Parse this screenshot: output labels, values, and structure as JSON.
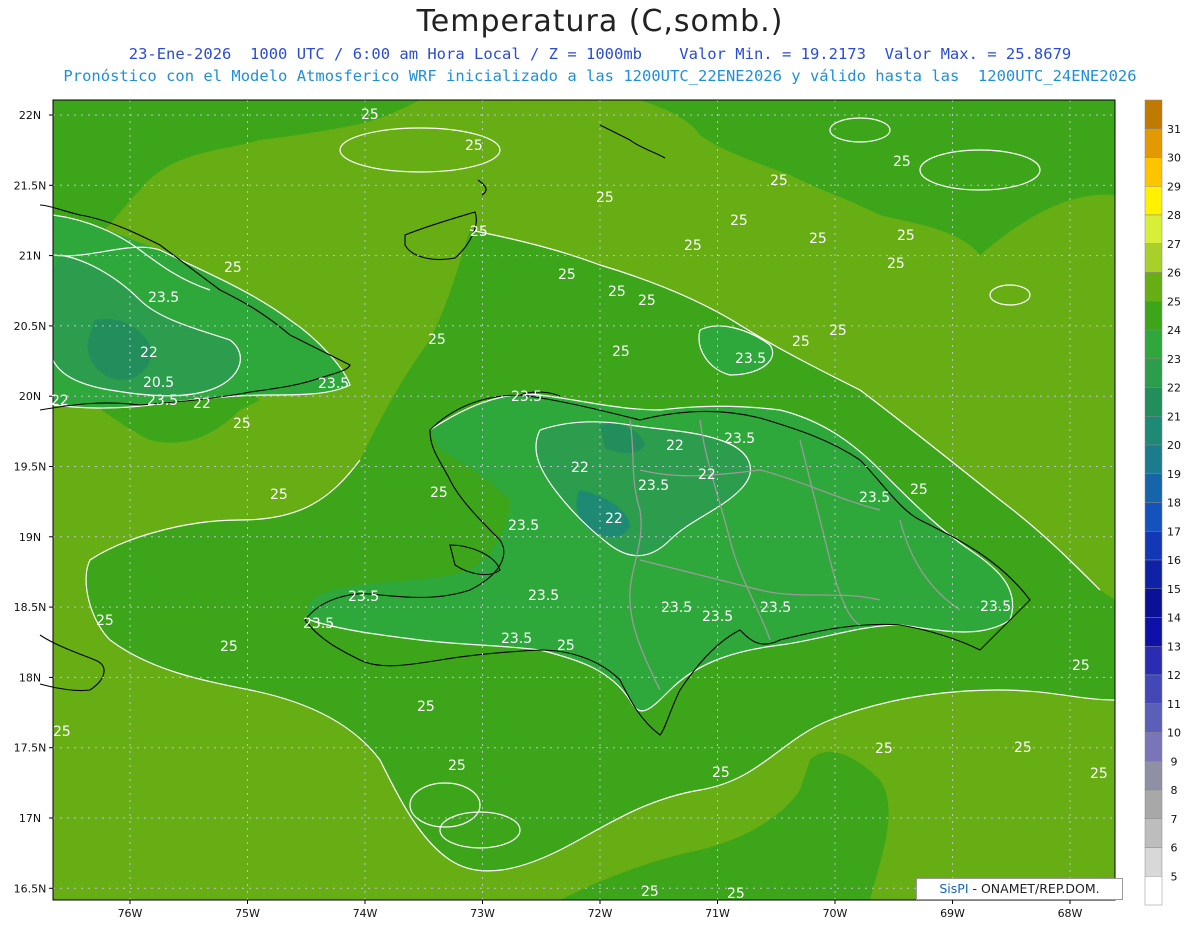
{
  "title": "Temperatura (C,somb.)",
  "subtitle_line1": "23-Ene-2026  1000 UTC / 6:00 am Hora Local / Z = 1000mb    Valor Min. = 19.2173  Valor Max. = 25.8679",
  "subtitle_line2": "Pronóstico con el Modelo Atmosferico WRF inicializado a las 1200UTC_22ENE2026 y válido hasta las  1200UTC_24ENE2026",
  "credit": {
    "brand": "SisPI",
    "text": " - ONAMET/REP.DOM."
  },
  "lat_labels": [
    "22N",
    "21.5N",
    "21N",
    "20.5N",
    "20N",
    "19.5N",
    "19N",
    "18.5N",
    "18N",
    "17.5N",
    "17N",
    "16.5N"
  ],
  "lon_labels": [
    "76W",
    "75W",
    "74W",
    "73W",
    "72W",
    "71W",
    "70W",
    "69W",
    "68W"
  ],
  "contour_labels": [
    "25",
    "23.5",
    "22",
    "20.5"
  ],
  "colorbar": {
    "levels": [
      {
        "value": "31",
        "color": "#c07a00"
      },
      {
        "value": "30",
        "color": "#e29a00"
      },
      {
        "value": "29",
        "color": "#ffc400"
      },
      {
        "value": "28",
        "color": "#fff100"
      },
      {
        "value": "27",
        "color": "#d8ef3a"
      },
      {
        "value": "26",
        "color": "#a8cf2a"
      },
      {
        "value": "25",
        "color": "#67ad14"
      },
      {
        "value": "24",
        "color": "#3ca51a"
      },
      {
        "value": "23",
        "color": "#2fa83b"
      },
      {
        "value": "22",
        "color": "#2b9d4d"
      },
      {
        "value": "21",
        "color": "#218e5c"
      },
      {
        "value": "20",
        "color": "#1e8a74"
      },
      {
        "value": "19",
        "color": "#1a7c8c"
      },
      {
        "value": "18",
        "color": "#1466a8"
      },
      {
        "value": "17",
        "color": "#1452be"
      },
      {
        "value": "16",
        "color": "#1238b8"
      },
      {
        "value": "15",
        "color": "#0f22a6"
      },
      {
        "value": "14",
        "color": "#0b1096"
      },
      {
        "value": "13",
        "color": "#0e10a8"
      },
      {
        "value": "12",
        "color": "#2a2db4"
      },
      {
        "value": "11",
        "color": "#4447b6"
      },
      {
        "value": "10",
        "color": "#5c5fb8"
      },
      {
        "value": "9",
        "color": "#7a74b8"
      },
      {
        "value": "8",
        "color": "#9090a4"
      },
      {
        "value": "7",
        "color": "#a8a8a8"
      },
      {
        "value": "6",
        "color": "#bdbdbd"
      },
      {
        "value": "5",
        "color": "#d8d8d8"
      },
      {
        "value": "",
        "color": "#ffffff"
      }
    ]
  },
  "colors": {
    "background_field": "#67ad14",
    "mid_field": "#3ca51a",
    "cool_field": "#2b9d4d",
    "contour": "#ffffff",
    "coast": "#000000",
    "borders": "#a0a0a0",
    "grid": "#b8b8d8"
  }
}
